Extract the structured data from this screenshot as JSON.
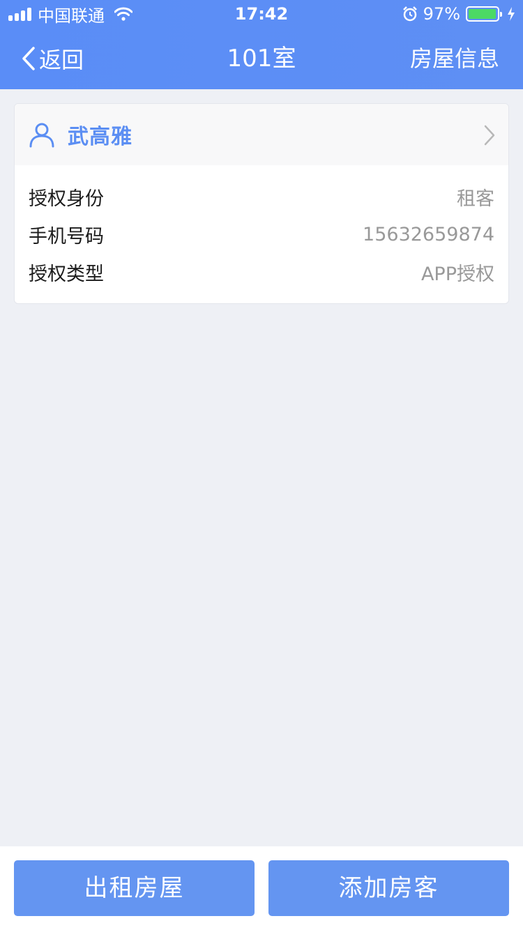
{
  "status_bar": {
    "carrier": "中国联通",
    "time": "17:42",
    "battery_percent": "97%",
    "battery_level": 0.97
  },
  "nav": {
    "back_label": "返回",
    "title": "101室",
    "right_label": "房屋信息"
  },
  "card": {
    "name": "武高雅",
    "rows": [
      {
        "label": "授权身份",
        "value": "租客"
      },
      {
        "label": "手机号码",
        "value": "15632659874"
      },
      {
        "label": "授权类型",
        "value": "APP授权"
      }
    ]
  },
  "actions": {
    "rent_out_label": "出租房屋",
    "add_tenant_label": "添加房客"
  },
  "colors": {
    "header": "#5a8df7",
    "accent": "#5b8ef3",
    "button": "#6495f1",
    "background": "#eef0f5"
  }
}
